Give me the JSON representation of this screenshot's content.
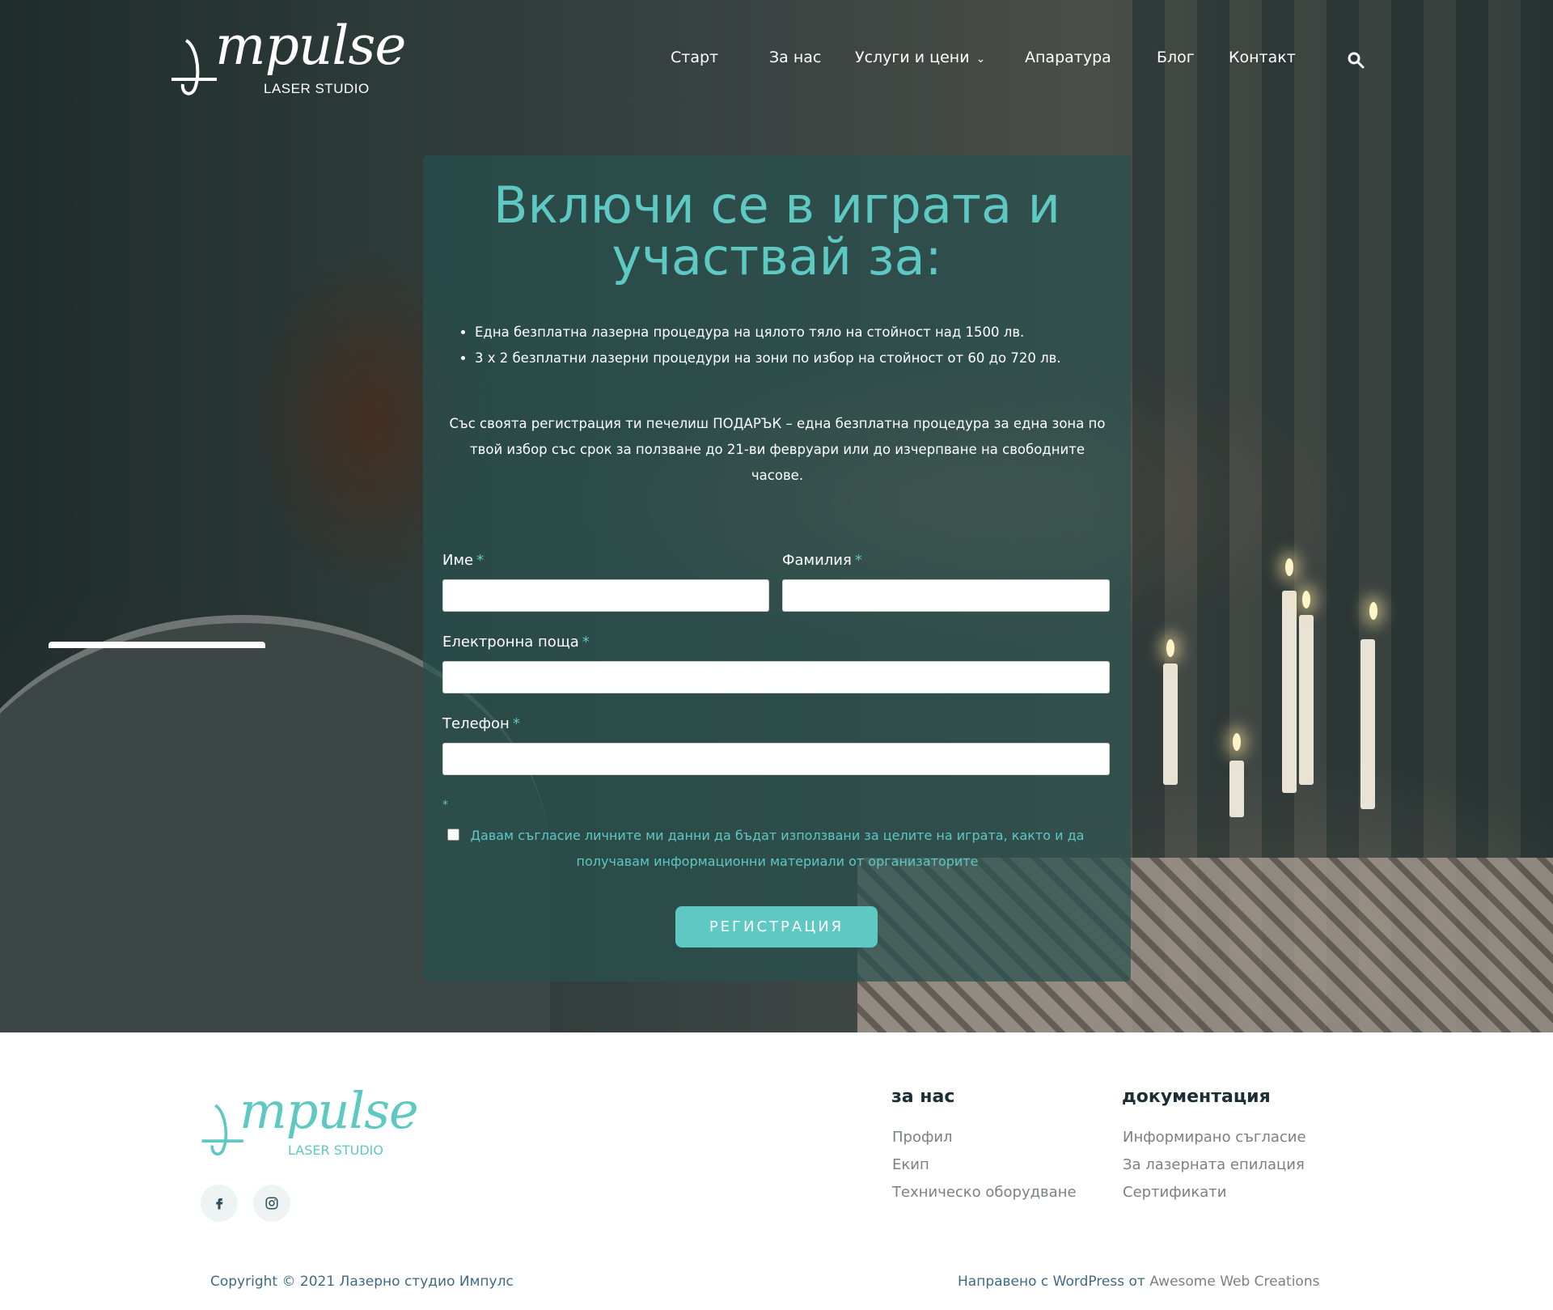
{
  "header": {
    "logo_word": "mpulse",
    "logo_sub": "LASER STUDIO",
    "nav": [
      {
        "label": "Старт"
      },
      {
        "label": "За нас"
      },
      {
        "label": "Услуги и цени"
      },
      {
        "label": "Апаратура"
      },
      {
        "label": "Блог"
      },
      {
        "label": "Контакт"
      }
    ],
    "search_icon": "search-icon"
  },
  "form": {
    "title": "Включи се в играта и участвай за:",
    "bullets": [
      "Една безплатна лазерна процедура на цялото тяло на стойност над 1500 лв.",
      "3 х 2 безплатни лазерни процедури на зони по избор на стойност от 60 до 720 лв."
    ],
    "note": "Със своята регистрация ти печелиш ПОДАРЪК – една безплатна процедура за една зона по твой избор със срок за ползване до 21-ви февруари или до изчерпване на свободните часове.",
    "fields": {
      "first_name": {
        "label": "Име",
        "value": ""
      },
      "last_name": {
        "label": "Фамилия",
        "value": ""
      },
      "email": {
        "label": "Електронна поща",
        "value": ""
      },
      "phone": {
        "label": "Телефон",
        "value": ""
      }
    },
    "required_mark": "*",
    "consent": "Давам съгласие личните ми данни да бъдат използвани за целите на играта, както и да получавам информационни материали от организаторите",
    "consent_checked": false,
    "submit": "РЕГИСТРАЦИЯ"
  },
  "footer": {
    "logo_word": "mpulse",
    "logo_sub": "LASER STUDIO",
    "social": [
      "facebook-icon",
      "instagram-icon"
    ],
    "col1": {
      "title": "за нас",
      "links": [
        "Профил",
        "Екип",
        "Техническо оборудване"
      ]
    },
    "col2": {
      "title": "документация",
      "links": [
        "Информирано съгласие",
        "За лазерната епилация",
        "Сертификати"
      ]
    },
    "copyright": "Copyright © 2021 Лазерно студио Импулс",
    "credit_prefix": "Направено с WordPress от",
    "credit_link": "Awesome Web Creations"
  },
  "colors": {
    "accent": "#5ec8c3",
    "card_bg": "#28504e",
    "footer_text": "#3f6a87"
  }
}
